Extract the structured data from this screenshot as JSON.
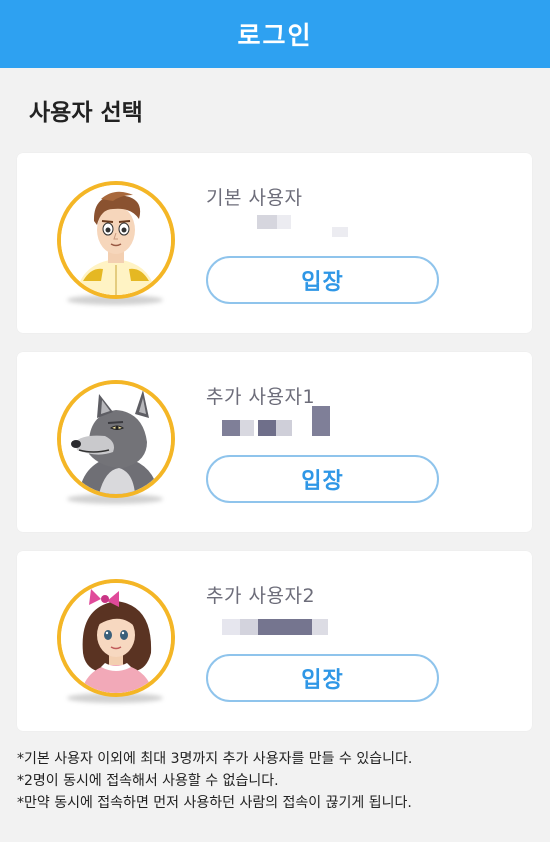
{
  "header": {
    "title": "로그인",
    "color": "#2ea1f1"
  },
  "section_title": "사용자 선택",
  "users": [
    {
      "name": "기본 사용자",
      "avatar": "prince-avatar",
      "button_label": "입장"
    },
    {
      "name": "추가 사용자1",
      "avatar": "wolf-avatar",
      "button_label": "입장"
    },
    {
      "name": "추가 사용자2",
      "avatar": "girl-avatar",
      "button_label": "입장"
    }
  ],
  "notes": [
    "*기본 사용자 이외에 최대 3명까지 추가 사용자를 만들 수 있습니다.",
    "*2명이 동시에 접속해서 사용할 수 없습니다.",
    "*만약 동시에 접속하면 먼저 사용하던 사람의 접속이 끊기게 됩니다."
  ],
  "colors": {
    "accent": "#2f97e6",
    "button_border": "#8fc4ec",
    "avatar_ring": "#f4b626",
    "background": "#f2f2f2"
  }
}
